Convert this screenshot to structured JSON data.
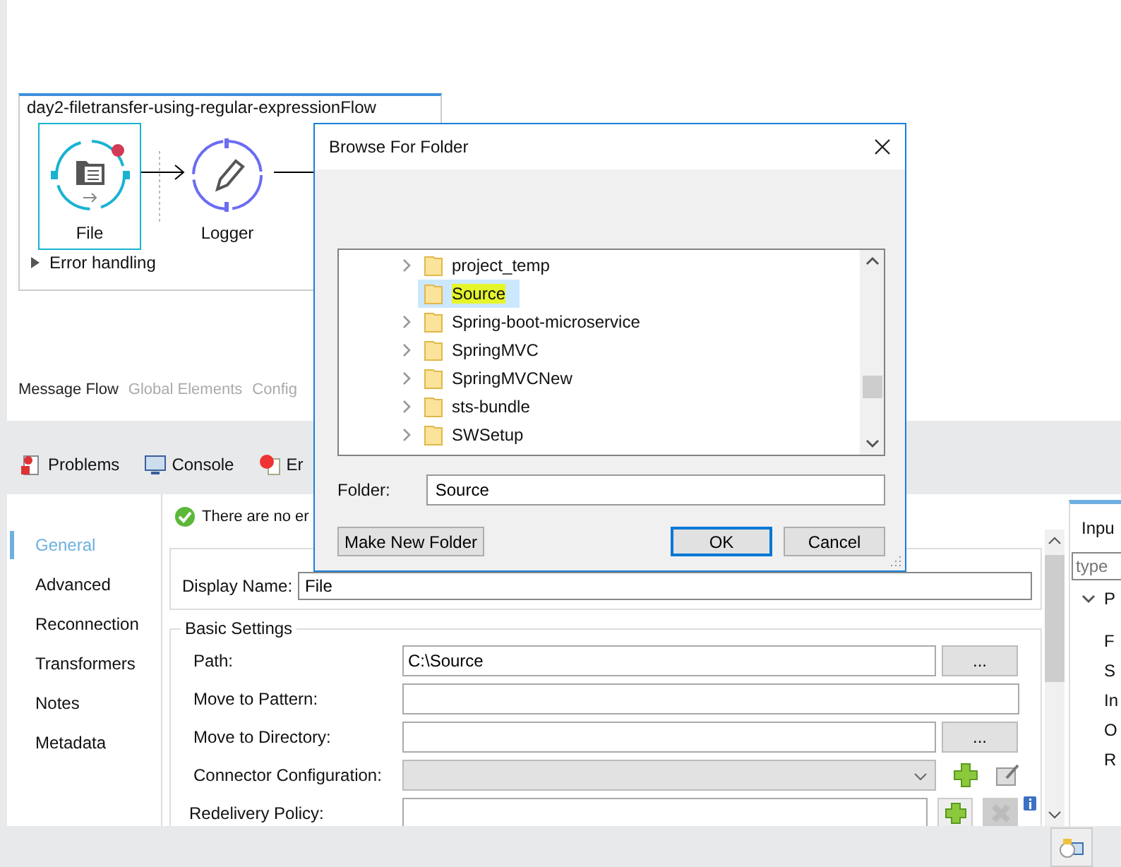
{
  "flow": {
    "title": "day2-filetransfer-using-regular-expressionFlow",
    "nodes": [
      {
        "label": "File",
        "kind": "file",
        "selected": true,
        "error": true
      },
      {
        "label": "Logger",
        "kind": "logger",
        "selected": false,
        "error": false
      }
    ],
    "error_handling": {
      "label": "Error handling",
      "expanded": false
    }
  },
  "editor_tabs": [
    {
      "label": "Message Flow",
      "selected": true
    },
    {
      "label": "Global Elements",
      "selected": false
    },
    {
      "label": "Config",
      "selected": false
    }
  ],
  "view_tabs": [
    {
      "label": "Problems",
      "kind": "problems"
    },
    {
      "label": "Console",
      "kind": "console"
    },
    {
      "label": "Er",
      "kind": "errors"
    }
  ],
  "properties": {
    "nav": [
      {
        "label": "General",
        "selected": true
      },
      {
        "label": "Advanced",
        "selected": false
      },
      {
        "label": "Reconnection",
        "selected": false
      },
      {
        "label": "Transformers",
        "selected": false
      },
      {
        "label": "Notes",
        "selected": false
      },
      {
        "label": "Metadata",
        "selected": false
      }
    ],
    "status": "There are no er",
    "display_name": {
      "label": "Display Name:",
      "value": "File"
    },
    "basic_settings": {
      "title": "Basic Settings",
      "rows": [
        {
          "label": "Path:",
          "kind": "browse",
          "value": "C:\\Source",
          "button": "..."
        },
        {
          "label": "Move to Pattern:",
          "kind": "text"
        },
        {
          "label": "Move to Directory:",
          "kind": "browse",
          "button": "..."
        },
        {
          "label": "Connector Configuration:",
          "kind": "select",
          "disabled": true
        },
        {
          "label": "Redelivery Policy:",
          "kind": "policy"
        }
      ]
    }
  },
  "right_panel": {
    "tab": "Inpu",
    "search_placeholder": "type",
    "tree": [
      {
        "label": "P",
        "expanded": true,
        "children": [
          {
            "label": "F"
          },
          {
            "label": "S"
          },
          {
            "label": "In"
          },
          {
            "label": "O"
          },
          {
            "label": "R"
          }
        ]
      }
    ]
  },
  "dialog": {
    "title": "Browse For Folder",
    "folders": [
      {
        "label": "project_temp",
        "expandable": true,
        "selected": false
      },
      {
        "label": "Source",
        "expandable": false,
        "selected": true
      },
      {
        "label": "Spring-boot-microservice",
        "expandable": true,
        "selected": false
      },
      {
        "label": "SpringMVC",
        "expandable": true,
        "selected": false
      },
      {
        "label": "SpringMVCNew",
        "expandable": true,
        "selected": false
      },
      {
        "label": "sts-bundle",
        "expandable": true,
        "selected": false
      },
      {
        "label": "SWSetup",
        "expandable": true,
        "selected": false
      }
    ],
    "folder_label": "Folder:",
    "folder_value": "Source",
    "buttons": [
      {
        "label": "Make New Folder",
        "kind": "new"
      },
      {
        "label": "OK",
        "kind": "default"
      },
      {
        "label": "Cancel",
        "kind": "cancel"
      }
    ]
  }
}
